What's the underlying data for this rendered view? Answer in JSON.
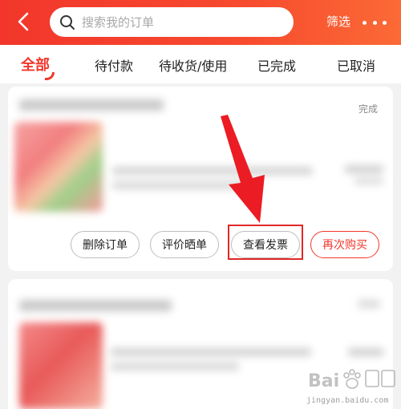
{
  "header": {
    "search_placeholder": "搜索我的订单",
    "filter_label": "筛选",
    "colors": {
      "gradient_start": "#f2362b",
      "gradient_end": "#fb6a36"
    },
    "icons": {
      "back": "back-chevron-icon",
      "search": "search-icon",
      "more": "more-dots-icon"
    }
  },
  "tabs": [
    {
      "label": "全部",
      "active": true
    },
    {
      "label": "待付款",
      "active": false
    },
    {
      "label": "待收货/使用",
      "active": false
    },
    {
      "label": "已完成",
      "active": false
    },
    {
      "label": "已取消",
      "active": false
    }
  ],
  "orders": [
    {
      "status": "完成",
      "actions": {
        "delete": "删除订单",
        "review": "评价晒单",
        "invoice": "查看发票",
        "rebuy": "再次购买"
      }
    }
  ],
  "watermark": {
    "site": "jingyan.baidu.com"
  },
  "accent_color": "#f2362b"
}
